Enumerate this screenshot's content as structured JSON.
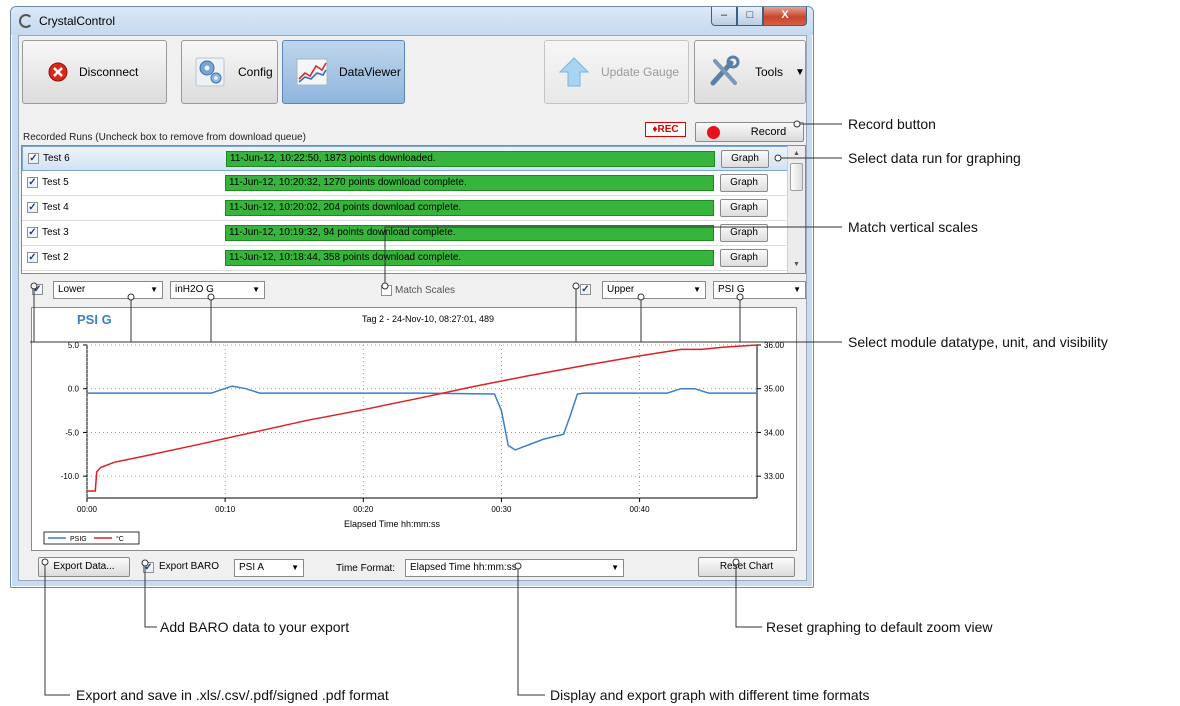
{
  "window": {
    "title": "CrystalControl",
    "min": "–",
    "max": "□",
    "close": "X"
  },
  "toolbar": {
    "disconnect": "Disconnect",
    "config": "Config",
    "dataviewer": "DataViewer",
    "update_gauge": "Update Gauge",
    "tools": "Tools"
  },
  "runs": {
    "label": "Recorded Runs (Uncheck box to remove from download queue)",
    "rec_badge": "♦REC",
    "record_label": "Record",
    "graph_label": "Graph",
    "items": [
      {
        "name": "Test 6",
        "status": "11-Jun-12, 10:22:50, 1873 points downloaded.",
        "checked": true,
        "selected": true
      },
      {
        "name": "Test 5",
        "status": "11-Jun-12, 10:20:32, 1270 points download complete.",
        "checked": true
      },
      {
        "name": "Test 4",
        "status": "11-Jun-12, 10:20:02, 204 points download complete.",
        "checked": true
      },
      {
        "name": "Test 3",
        "status": "11-Jun-12, 10:19:32, 94 points download complete.",
        "checked": true
      },
      {
        "name": "Test 2",
        "status": "11-Jun-12, 10:18:44, 358 points download complete.",
        "checked": true
      }
    ]
  },
  "modules": {
    "left_type": "Lower",
    "left_unit": "inH2O G",
    "match_scales": "Match Scales",
    "right_type": "Upper",
    "right_unit": "PSI G"
  },
  "chart_data": {
    "type": "line",
    "title": "Tag 2 - 24-Nov-10, 08:27:01, 489",
    "corner_label": "PSI G",
    "xlabel": "Elapsed Time hh:mm:ss",
    "x_ticks": [
      "00:00",
      "00:10",
      "00:20",
      "00:30",
      "00:40"
    ],
    "y_left_ticks": [
      "5.0",
      "0.0",
      "-5.0",
      "-10.0"
    ],
    "y_right_ticks": [
      "36.00",
      "35.00",
      "34.00",
      "33.00"
    ],
    "ylim_left": [
      -12.5,
      5.0
    ],
    "ylim_right": [
      32.5,
      36.0
    ],
    "xlim_min": [
      0,
      48.5
    ],
    "grid": true,
    "legend": "bottom-left",
    "colors": {
      "psig": "#3b7fc8",
      "temp": "#e02020"
    },
    "series": [
      {
        "name": "PSIG",
        "axis": "left",
        "x": [
          0,
          5,
          9,
          10.5,
          11.5,
          12.5,
          24,
          29.5,
          30,
          30.5,
          31,
          33,
          34.5,
          35,
          35.5,
          36,
          42,
          43,
          44,
          45,
          48.5
        ],
        "y": [
          -0.5,
          -0.5,
          -0.5,
          0.3,
          0.0,
          -0.5,
          -0.5,
          -0.6,
          -2.5,
          -6.5,
          -7.0,
          -5.8,
          -5.2,
          -3.0,
          -0.6,
          -0.5,
          -0.5,
          0.0,
          0.0,
          -0.5,
          -0.5
        ]
      },
      {
        "name": "°C",
        "axis": "right",
        "x": [
          0,
          0.6,
          0.7,
          1,
          2,
          4,
          8,
          12,
          16,
          20,
          24,
          28,
          32,
          36,
          40,
          43,
          44.5,
          46,
          48.5
        ],
        "y": [
          32.66,
          32.66,
          33.1,
          33.2,
          33.32,
          33.45,
          33.72,
          34.0,
          34.28,
          34.52,
          34.78,
          35.05,
          35.3,
          35.53,
          35.75,
          35.9,
          35.9,
          35.95,
          36.02
        ]
      }
    ],
    "legend_entries": [
      "PSIG",
      "°C"
    ]
  },
  "bottom": {
    "export_data": "Export Data...",
    "export_baro": "Export BARO",
    "baro_unit": "PSI A",
    "time_format_label": "Time Format:",
    "time_format_value": "Elapsed Time hh:mm:ss",
    "reset_chart": "Reset Chart"
  },
  "callouts": {
    "record": "Record button",
    "select_run": "Select data run for graphing",
    "match_scales": "Match vertical scales",
    "module": "Select module datatype, unit, and visibility",
    "baro": "Add BARO data to your export",
    "reset": "Reset graphing to default zoom view",
    "export": "Export and save in .xls/.csv/.pdf/signed .pdf format",
    "time_format": "Display and export graph with different time formats"
  }
}
